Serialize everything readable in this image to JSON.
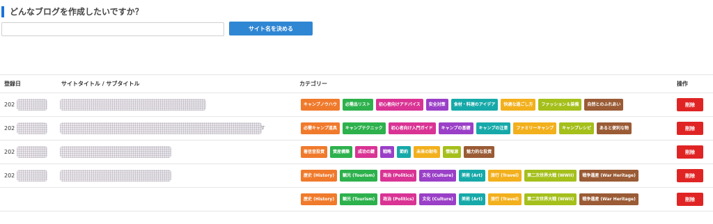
{
  "form": {
    "heading": "どんなブログを作成したいですか？",
    "input_value": "",
    "input_placeholder": "",
    "submit_label": "サイト名を決める"
  },
  "colors": {
    "accent": "#1a73d9",
    "button": "#2f86d3",
    "delete": "#e02424",
    "orange": "#f07a2c",
    "green": "#2db14c",
    "magenta": "#d93394",
    "purple": "#9a3fc7",
    "teal": "#17a9a9",
    "amber": "#f2b01d",
    "lime": "#a5bf1b",
    "brown": "#9a5b35"
  },
  "table": {
    "headers": {
      "date": "登録日",
      "title": "サイトタイトル / サブタイトル",
      "category": "カテゴリー",
      "action": "操作"
    },
    "rows": [
      {
        "date": "202",
        "title_suffix": "",
        "tags": [
          {
            "label": "キャンプノウハウ",
            "color": "#f07a2c"
          },
          {
            "label": "必需品リスト",
            "color": "#2db14c"
          },
          {
            "label": "初心者向けアドバイス",
            "color": "#d93394"
          },
          {
            "label": "安全対策",
            "color": "#9a3fc7"
          },
          {
            "label": "食材・料理のアイデア",
            "color": "#17a9a9"
          },
          {
            "label": "快適な過ごし方",
            "color": "#f2b01d"
          },
          {
            "label": "ファッション＆装備",
            "color": "#a5bf1b"
          },
          {
            "label": "自然とのふれあい",
            "color": "#9a5b35"
          }
        ],
        "delete_label": "削除"
      },
      {
        "date": "202",
        "title_suffix": "す",
        "tags": [
          {
            "label": "必需キャンプ道具",
            "color": "#f07a2c"
          },
          {
            "label": "キャンプテクニック",
            "color": "#2db14c"
          },
          {
            "label": "初心者向け入門ガイド",
            "color": "#d93394"
          },
          {
            "label": "キャンプの基礎",
            "color": "#9a3fc7"
          },
          {
            "label": "キャンプの注意",
            "color": "#17a9a9"
          },
          {
            "label": "ファミリーキャンプ",
            "color": "#f2b01d"
          },
          {
            "label": "キャンプレシピ",
            "color": "#a5bf1b"
          },
          {
            "label": "あると便利な物",
            "color": "#9a5b35"
          }
        ],
        "delete_label": "削除"
      },
      {
        "date": "202",
        "title_suffix": "",
        "tags": [
          {
            "label": "着信音投資",
            "color": "#f07a2c"
          },
          {
            "label": "資産構築",
            "color": "#2db14c"
          },
          {
            "label": "成功の鍵",
            "color": "#d93394"
          },
          {
            "label": "戦略",
            "color": "#9a3fc7"
          },
          {
            "label": "節約",
            "color": "#17a9a9"
          },
          {
            "label": "未来の財布",
            "color": "#f2b01d"
          },
          {
            "label": "情報源",
            "color": "#a5bf1b"
          },
          {
            "label": "魅力的な投資",
            "color": "#9a5b35"
          }
        ],
        "delete_label": "削除"
      },
      {
        "date": "202",
        "title_suffix": "",
        "tags": [
          {
            "label": "歴史 (History)",
            "color": "#f07a2c"
          },
          {
            "label": "観光 (Tourism)",
            "color": "#2db14c"
          },
          {
            "label": "政治 (Politics)",
            "color": "#d93394"
          },
          {
            "label": "文化 (Culture)",
            "color": "#9a3fc7"
          },
          {
            "label": "美術 (Art)",
            "color": "#17a9a9"
          },
          {
            "label": "旅行 (Travel)",
            "color": "#f2b01d"
          },
          {
            "label": "第二次世界大戦 (WWII)",
            "color": "#a5bf1b"
          },
          {
            "label": "戦争遺産 (War Heritage)",
            "color": "#9a5b35"
          }
        ],
        "delete_label": "削除"
      },
      {
        "date": "",
        "title_suffix": "",
        "tags": [
          {
            "label": "歴史 (History)",
            "color": "#f07a2c"
          },
          {
            "label": "観光 (Tourism)",
            "color": "#2db14c"
          },
          {
            "label": "政治 (Politics)",
            "color": "#d93394"
          },
          {
            "label": "文化 (Culture)",
            "color": "#9a3fc7"
          },
          {
            "label": "美術 (Art)",
            "color": "#17a9a9"
          },
          {
            "label": "旅行 (Travel)",
            "color": "#f2b01d"
          },
          {
            "label": "第二次世界大戦 (WWII)",
            "color": "#a5bf1b"
          },
          {
            "label": "戦争遺産 (War Heritage)",
            "color": "#9a5b35"
          }
        ],
        "delete_label": "削除"
      }
    ]
  }
}
